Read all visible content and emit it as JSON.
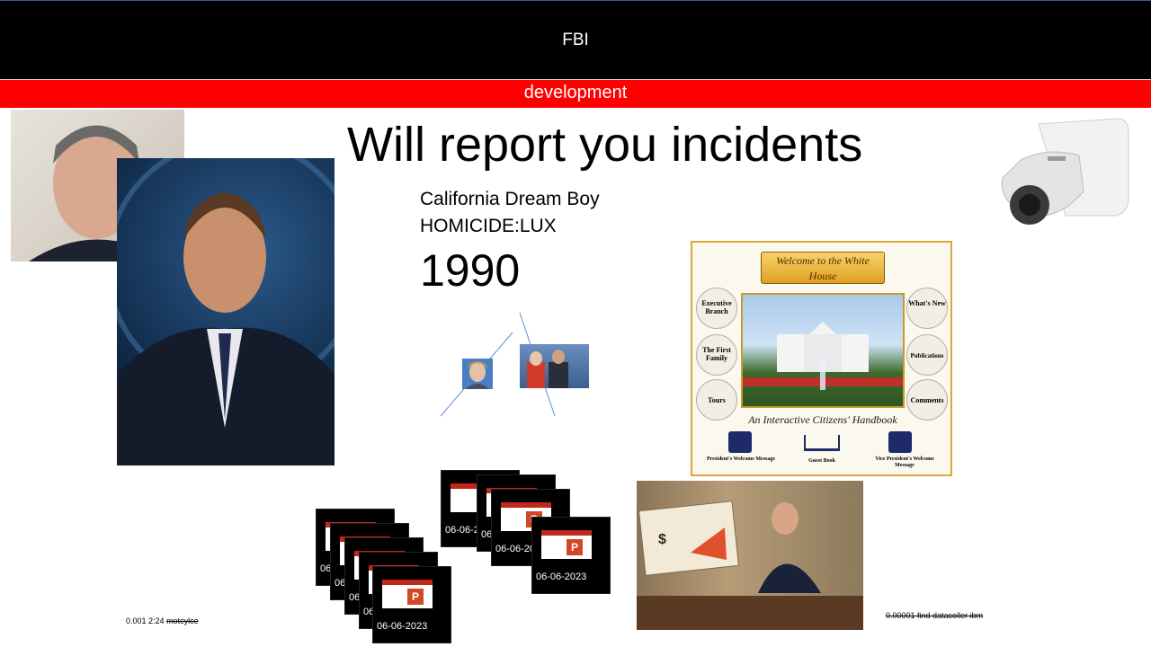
{
  "header": {
    "title": "FBI"
  },
  "banner": {
    "text": "development"
  },
  "main": {
    "headline": "Will report you incidents",
    "subtitle_1": "California Dream Boy",
    "subtitle_2": "HOMICIDE:LUX",
    "year": "1990"
  },
  "whitehouse_panel": {
    "banner": "Welcome to the White House",
    "seal_items": [
      "Executive Branch",
      "The First Family",
      "Tours",
      "What's New",
      "Publications",
      "Comments"
    ],
    "caption": "An Interactive Citizens' Handbook",
    "bottom_items": [
      "President's Welcome Message",
      "Guest Book",
      "Vice President's Welcome Message"
    ]
  },
  "thumbnails": {
    "date_label": "06-06-2023",
    "partial_label_1": "06",
    "partial_label_2": "06-06-2",
    "ppt_letter": "P"
  },
  "footnotes": {
    "left_values": "0.001 2:24",
    "left_struck": "motcylce",
    "right_struck": "0.00001 find datacoller ibm"
  },
  "icons": [
    "security-camera-icon",
    "powerpoint-icon"
  ],
  "colors": {
    "topbar": "#000000",
    "banner": "#ff0000"
  }
}
